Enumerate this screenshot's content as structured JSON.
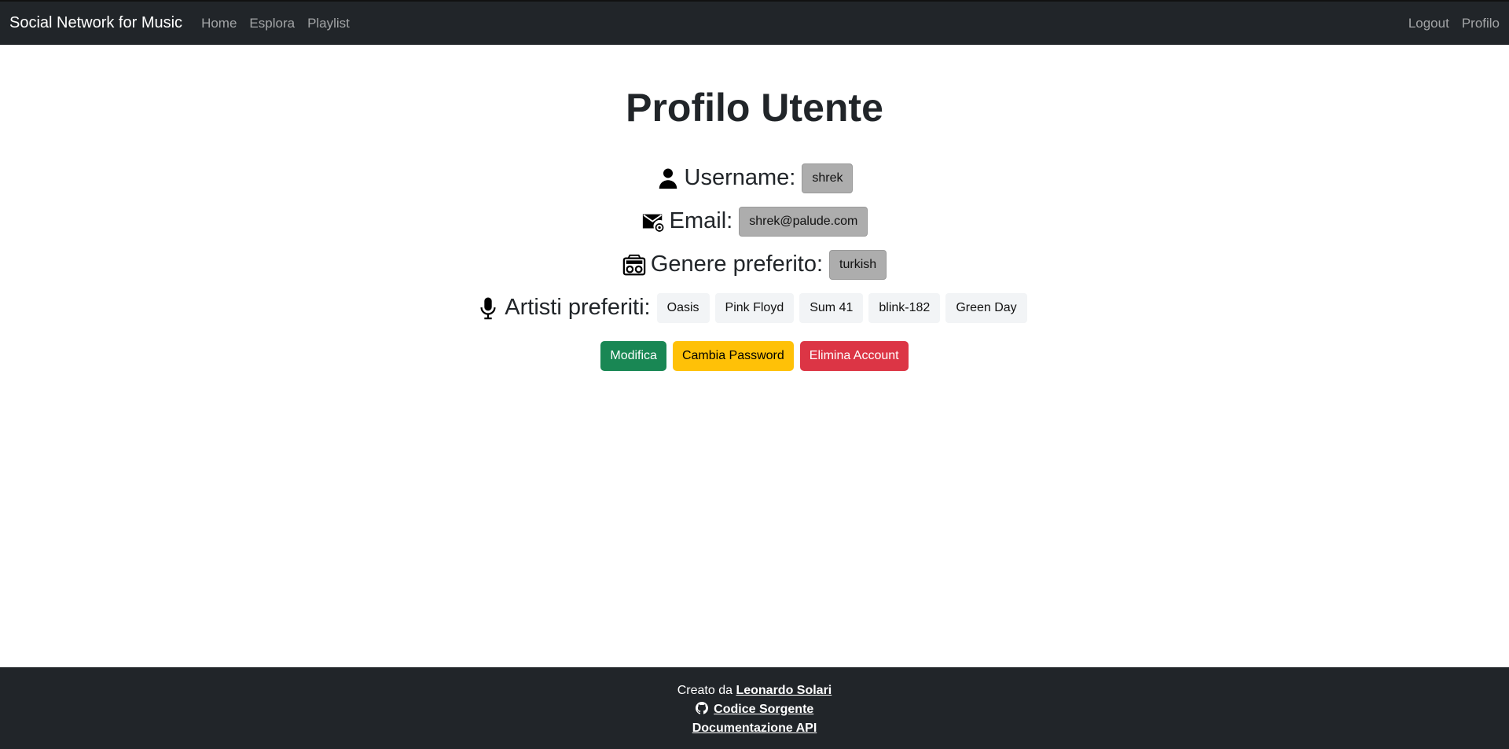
{
  "navbar": {
    "brand": "Social Network for Music",
    "links": [
      "Home",
      "Esplora",
      "Playlist"
    ],
    "right_links": [
      "Logout",
      "Profilo"
    ]
  },
  "profile": {
    "title": "Profilo Utente",
    "username_label": "Username:",
    "username_value": "shrek",
    "email_label": "Email:",
    "email_value": "shrek@palude.com",
    "genre_label": "Genere preferito:",
    "genre_value": "turkish",
    "artists_label": "Artisti preferiti:",
    "artists": [
      "Oasis",
      "Pink Floyd",
      "Sum 41",
      "blink-182",
      "Green Day"
    ]
  },
  "actions": {
    "edit": "Modifica",
    "change_password": "Cambia Password",
    "delete_account": "Elimina Account"
  },
  "footer": {
    "created_by_prefix": "Creato da",
    "author": "Leonardo Solari",
    "source_code": "Codice Sorgente",
    "api_docs": "Documentazione API"
  },
  "icons": {
    "username": "person-icon",
    "email": "envelope-at-icon",
    "genre": "boombox-icon",
    "artists": "microphone-icon",
    "source": "github-icon"
  },
  "colors": {
    "navbar_bg": "#212529",
    "success": "#198754",
    "warning": "#ffc107",
    "danger": "#dc3545",
    "badge_gray": "#adadad"
  }
}
